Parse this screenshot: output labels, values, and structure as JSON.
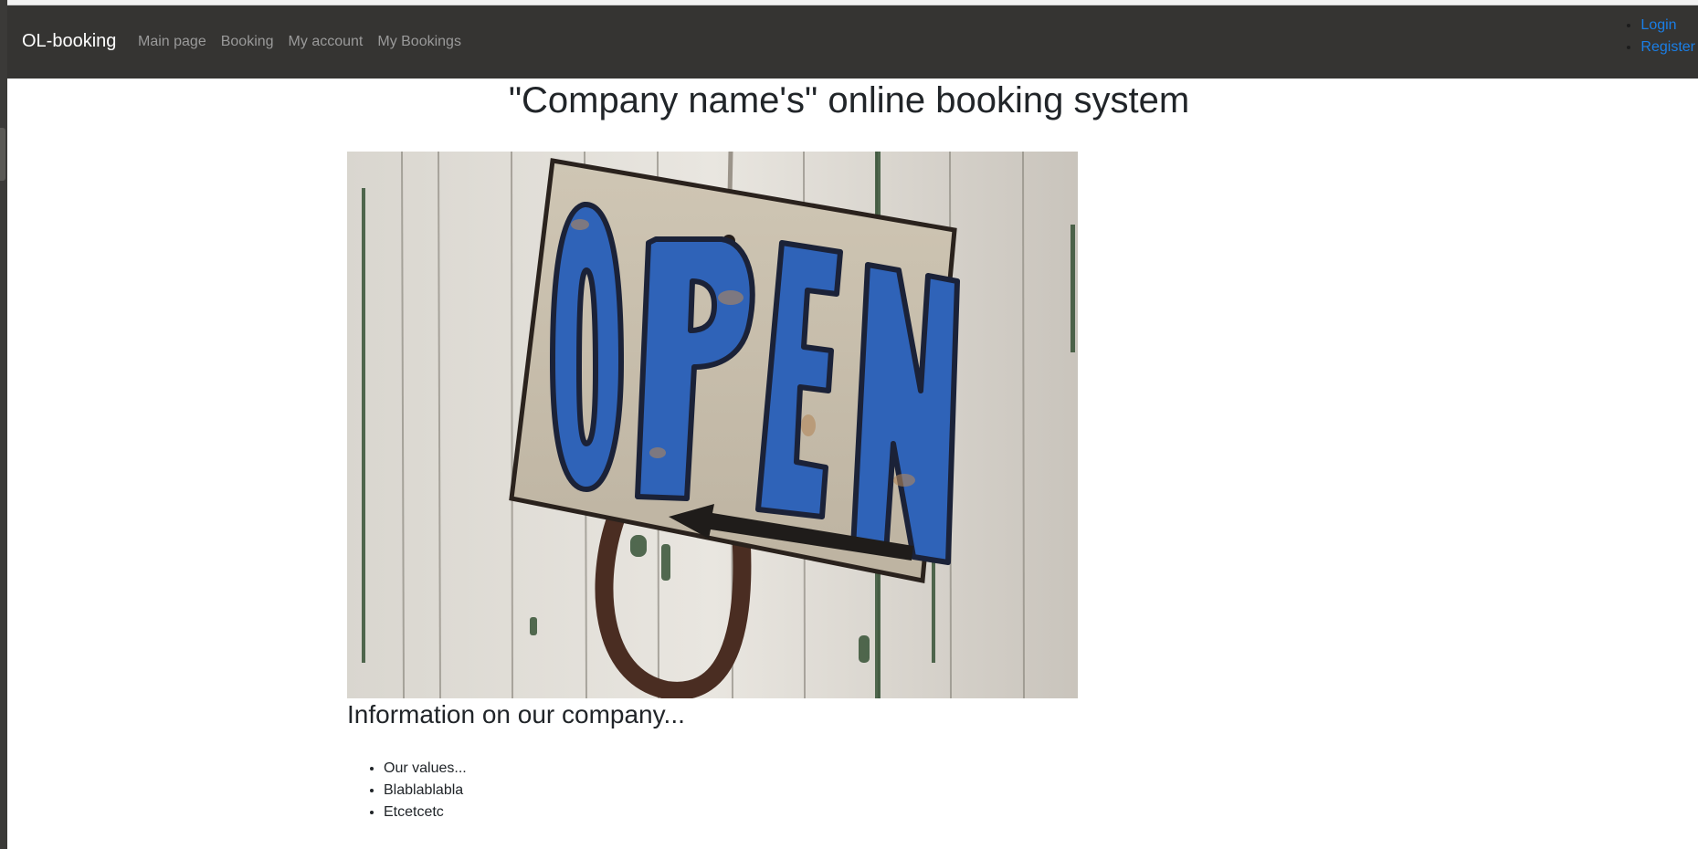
{
  "navbar": {
    "brand": "OL-booking",
    "links": [
      {
        "label": "Main page"
      },
      {
        "label": "Booking"
      },
      {
        "label": "My account"
      },
      {
        "label": "My Bookings"
      }
    ],
    "auth": [
      {
        "label": "Login"
      },
      {
        "label": "Register"
      }
    ]
  },
  "main": {
    "title": "\"Company name's\" online booking system",
    "hero_image": {
      "icon": "open-sign-image",
      "sign_text": "OPEN"
    },
    "info_heading": "Information on our company...",
    "info_items": [
      {
        "text": "Our values..."
      },
      {
        "text": "Blablablabla"
      },
      {
        "text": "Etcetcetc"
      }
    ]
  },
  "colors": {
    "navbar_bg": "#353432",
    "brand": "#ffffff",
    "nav_link": "#9a9a9a",
    "auth_link": "#1a7ee6",
    "sign_blue": "#2f63b8"
  }
}
